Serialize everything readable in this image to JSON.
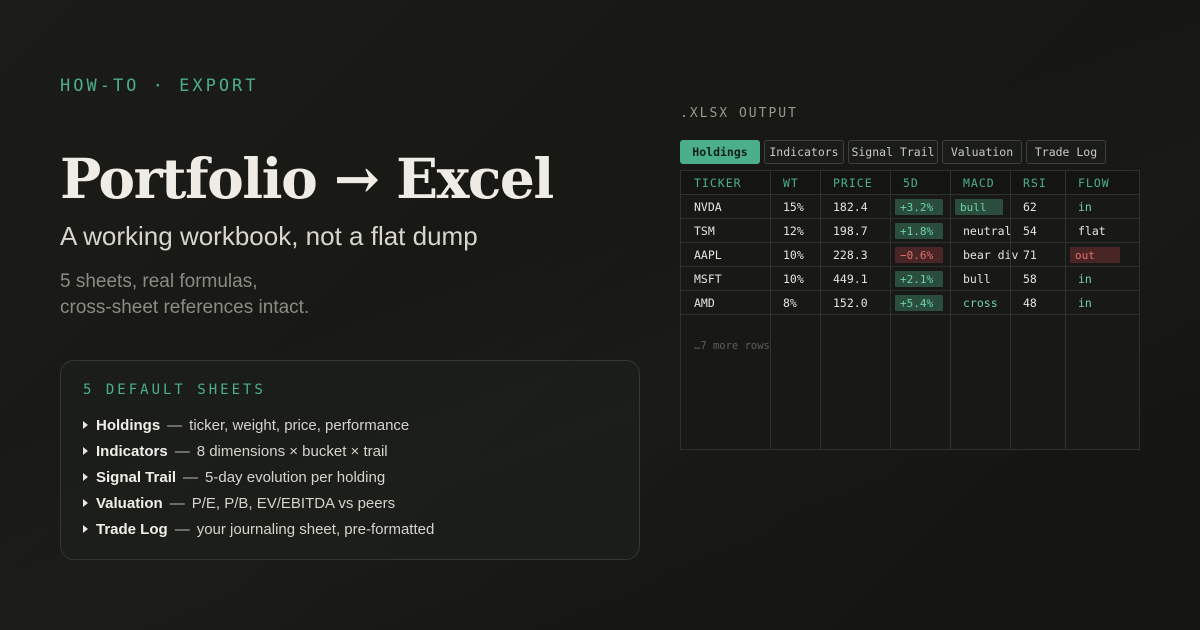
{
  "eyebrow": "HOW-TO · EXPORT",
  "title": "Portfolio → Excel",
  "subtitle": "A working workbook, not a flat dump",
  "description": {
    "line1": "5 sheets, real formulas,",
    "line2": "cross-sheet references intact."
  },
  "card": {
    "title": "5 DEFAULT SHEETS",
    "items": [
      {
        "name": "Holdings",
        "desc": "ticker, weight, price, performance"
      },
      {
        "name": "Indicators",
        "desc": "8 dimensions × bucket × trail"
      },
      {
        "name": "Signal Trail",
        "desc": "5-day evolution per holding"
      },
      {
        "name": "Valuation",
        "desc": "P/E, P/B, EV/EBITDA vs peers"
      },
      {
        "name": "Trade Log",
        "desc": "your journaling sheet, pre-formatted"
      }
    ],
    "dash": "—"
  },
  "output_label": ".XLSX OUTPUT",
  "tabs": [
    "Holdings",
    "Indicators",
    "Signal Trail",
    "Valuation",
    "Trade Log"
  ],
  "active_tab": "Holdings",
  "table": {
    "headers": [
      "TICKER",
      "WT",
      "PRICE",
      "5D",
      "MACD",
      "RSI",
      "FLOW"
    ],
    "rows": [
      {
        "ticker": "NVDA",
        "wt": "15%",
        "price": "182.4",
        "d5": "+3.2%",
        "d5_dir": "up",
        "macd": "bull",
        "macd_style": "good",
        "rsi": "62",
        "flow": "in",
        "flow_style": "green"
      },
      {
        "ticker": "TSM",
        "wt": "12%",
        "price": "198.7",
        "d5": "+1.8%",
        "d5_dir": "up",
        "macd": "neutral",
        "macd_style": "plain",
        "rsi": "54",
        "flow": "flat",
        "flow_style": "plain"
      },
      {
        "ticker": "AAPL",
        "wt": "10%",
        "price": "228.3",
        "d5": "−0.6%",
        "d5_dir": "down",
        "macd": "bear div",
        "macd_style": "plain",
        "rsi": "71",
        "flow": "out",
        "flow_style": "bad"
      },
      {
        "ticker": "MSFT",
        "wt": "10%",
        "price": "449.1",
        "d5": "+2.1%",
        "d5_dir": "up",
        "macd": "bull",
        "macd_style": "plain",
        "rsi": "58",
        "flow": "in",
        "flow_style": "green"
      },
      {
        "ticker": "AMD",
        "wt": "8%",
        "price": "152.0",
        "d5": "+5.4%",
        "d5_dir": "up",
        "macd": "cross",
        "macd_style": "green",
        "rsi": "48",
        "flow": "in",
        "flow_style": "green"
      }
    ],
    "more_rows": "…7 more rows"
  },
  "colors": {
    "accent": "#4bb08a",
    "positive_bg": "#2a4d3d",
    "negative_bg": "#4a2525",
    "background": "#1b1b18"
  }
}
